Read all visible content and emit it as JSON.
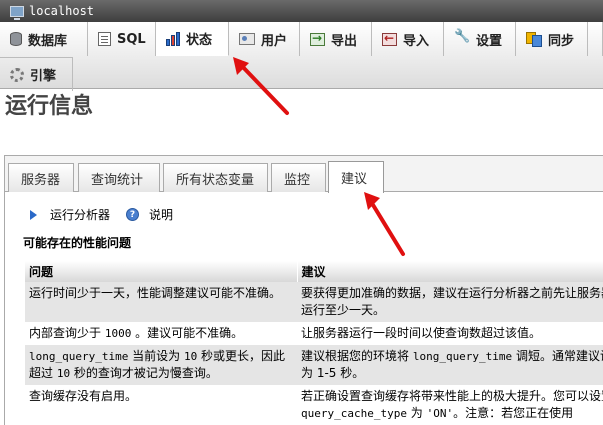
{
  "server": {
    "title": "localhost"
  },
  "menu": {
    "tabs": [
      {
        "label": "数据库",
        "icon": "database-icon"
      },
      {
        "label": "SQL",
        "icon": "sql-icon"
      },
      {
        "label": "状态",
        "icon": "status-icon",
        "active": true
      },
      {
        "label": "用户",
        "icon": "users-icon"
      },
      {
        "label": "导出",
        "icon": "export-icon"
      },
      {
        "label": "导入",
        "icon": "import-icon"
      },
      {
        "label": "设置",
        "icon": "wrench-icon"
      },
      {
        "label": "同步",
        "icon": "sync-icon"
      },
      {
        "label": "引擎",
        "icon": "engine-icon"
      }
    ]
  },
  "page": {
    "title": "运行信息"
  },
  "subtabs": [
    {
      "label": "服务器"
    },
    {
      "label": "查询统计"
    },
    {
      "label": "所有状态变量"
    },
    {
      "label": "监控"
    },
    {
      "label": "建议",
      "active": true
    }
  ],
  "tools": {
    "run_analyzer": "运行分析器",
    "help": "说明"
  },
  "advisor": {
    "heading": "可能存在的性能问题",
    "columns": {
      "problem": "问题",
      "advice": "建议"
    },
    "rows": [
      {
        "problem": "运行时间少于一天，性能调整建议可能不准确。",
        "advice": "要获得更加准确的数据，建议在运行分析器之前先让服务器运行至少一天。"
      },
      {
        "problem_pre": "内部查询少于 ",
        "problem_code": "1000",
        "problem_post": " 。建议可能不准确。",
        "advice": "让服务器运行一段时间以使查询数超过该值。"
      },
      {
        "problem_code": "long_query_time",
        "problem_mid": " 当前设为 ",
        "problem_code2": "10",
        "problem_post": " 秒或更长，因此超过 ",
        "problem_code3": "10",
        "problem_tail": " 秒的查询才被记为慢查询。",
        "advice_pre": "建议根据您的环境将 ",
        "advice_code": "long_query_time",
        "advice_post": " 调短。通常建议设为 1-5 秒。"
      },
      {
        "problem": "查询缓存没有启用。",
        "advice_pre": "若正确设置查询缓存将带来性能上的极大提升。您可以设置 ",
        "advice_code": "query_cache_type",
        "advice_mid": " 为 ",
        "advice_code2": "'ON'",
        "advice_post": "。注意：若您正在使用"
      }
    ]
  },
  "colors": {
    "annotation": "#e01010",
    "active_tab_bg": "#ffffff"
  }
}
